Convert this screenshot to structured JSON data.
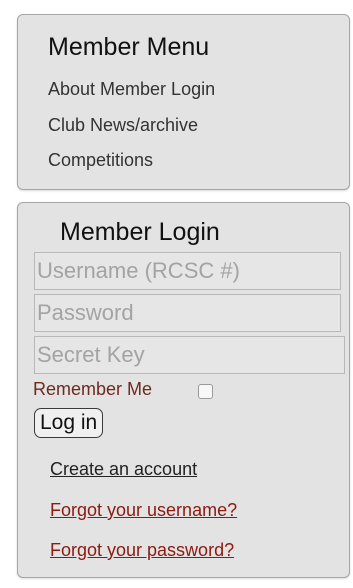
{
  "member_menu": {
    "title": "Member Menu",
    "items": [
      {
        "label": "About Member Login"
      },
      {
        "label": "Club News/archive"
      },
      {
        "label": "Competitions"
      }
    ]
  },
  "member_login": {
    "title": "Member Login",
    "username": {
      "value": "",
      "placeholder": "Username (RCSC #)"
    },
    "password": {
      "value": "",
      "placeholder": "Password"
    },
    "secret_key": {
      "value": "",
      "placeholder": "Secret Key"
    },
    "remember_me": {
      "label": "Remember Me",
      "checked": false
    },
    "login_button": {
      "label": "Log in"
    },
    "links": {
      "create_account": "Create an account",
      "forgot_username": "Forgot your username?",
      "forgot_password": "Forgot your password?"
    }
  },
  "colors": {
    "panel_background": "#e3e3e3",
    "panel_border": "#a6a6a6",
    "link_dark_red": "#8b1a10",
    "remember_label": "#6f2a1e"
  }
}
